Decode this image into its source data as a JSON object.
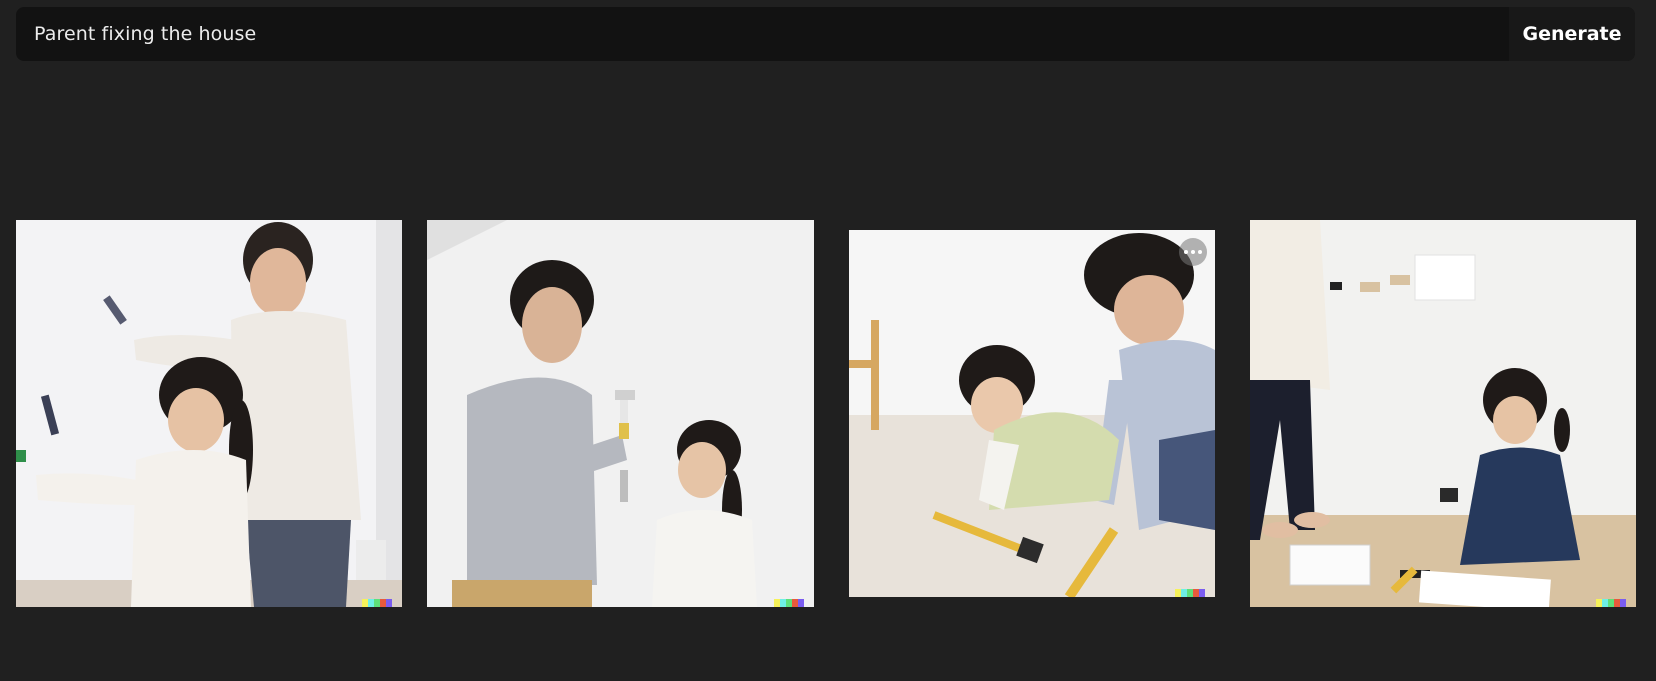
{
  "prompt": {
    "value": "Parent fixing the house",
    "generate_label": "Generate"
  },
  "results": [
    {
      "id_label": "image-1",
      "description_icon": "image-thumbnail"
    },
    {
      "id_label": "image-2",
      "description_icon": "image-thumbnail"
    },
    {
      "id_label": "image-3",
      "description_icon": "image-thumbnail",
      "has_more_menu": true
    },
    {
      "id_label": "image-4",
      "description_icon": "image-thumbnail"
    }
  ],
  "colors": {
    "background": "#202020",
    "prompt_bar": "#121212",
    "watermark": [
      "#f6f25a",
      "#6ef0e6",
      "#5ee07a",
      "#e85a3c",
      "#7a5cf0"
    ]
  }
}
